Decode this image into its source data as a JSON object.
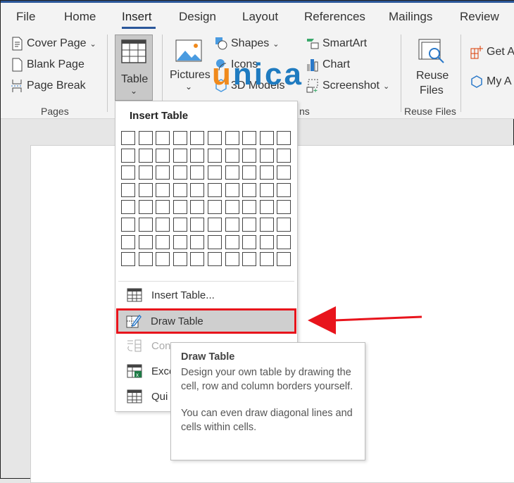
{
  "tabs": [
    "File",
    "Home",
    "Insert",
    "Design",
    "Layout",
    "References",
    "Mailings",
    "Review"
  ],
  "active_tab": "Insert",
  "ribbon": {
    "pages": {
      "cover_page": "Cover Page",
      "blank_page": "Blank Page",
      "page_break": "Page Break",
      "label": "Pages"
    },
    "table": {
      "label": "Table"
    },
    "illustrations": {
      "pictures": "Pictures",
      "shapes": "Shapes",
      "icons": "Icons",
      "models": "3D Models",
      "smartart": "SmartArt",
      "chart": "Chart",
      "screenshot": "Screenshot",
      "label_fragment": "ns"
    },
    "reuse": {
      "button_line1": "Reuse",
      "button_line2": "Files",
      "label": "Reuse Files"
    },
    "addins": {
      "get": "Get A",
      "my": "My A"
    }
  },
  "watermark": {
    "text": "unica"
  },
  "menu": {
    "title": "Insert Table",
    "grid_cols": 10,
    "grid_rows": 8,
    "items": [
      {
        "label": "Insert Table...",
        "icon": "table-icon",
        "disabled": false
      },
      {
        "label": "Draw Table",
        "icon": "draw-table-icon",
        "disabled": false,
        "highlighted": true
      },
      {
        "label": "Con",
        "icon": "convert-text-icon",
        "disabled": true
      },
      {
        "label": "Exce",
        "icon": "excel-table-icon",
        "disabled": false
      },
      {
        "label": "Qui",
        "icon": "quick-table-icon",
        "disabled": false
      }
    ]
  },
  "tooltip": {
    "title": "Draw Table",
    "body1": "Design your own table by drawing the cell, row and column borders yourself.",
    "body2": "You can even draw diagonal lines and cells within cells."
  },
  "colors": {
    "accent": "#2b579a",
    "highlight_border": "#e8141c",
    "arrow": "#e8141c"
  }
}
